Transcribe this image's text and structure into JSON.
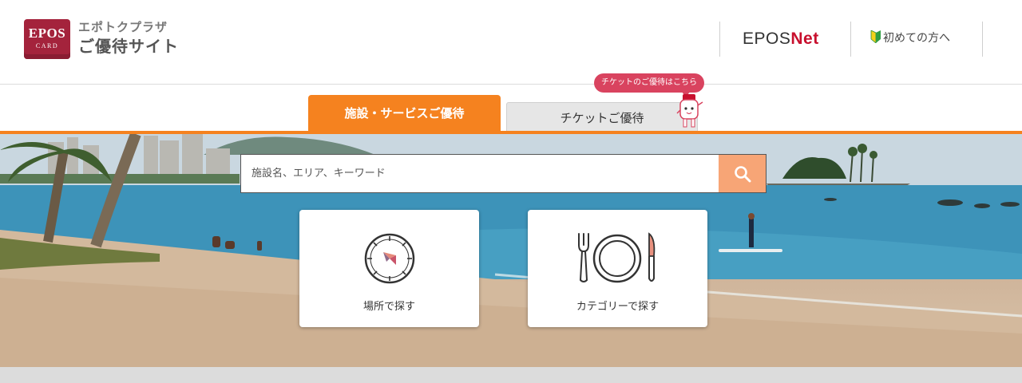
{
  "header": {
    "logo": {
      "line1": "EPOS",
      "line2": "CARD"
    },
    "site_kana": "エポトクプラザ",
    "site_title": "ご優待サイト",
    "eposnet": {
      "part1": "EPOS",
      "part2": "Net"
    },
    "first_time_link": "初めての方へ"
  },
  "tabs": {
    "active": "施設・サービスご優待",
    "inactive": "チケットご優待",
    "bubble": "チケットのご優待はこちら"
  },
  "search": {
    "placeholder": "施設名、エリア、キーワード",
    "value": "",
    "button_icon": "search-icon"
  },
  "cards": [
    {
      "label": "場所で探す",
      "icon": "compass-icon"
    },
    {
      "label": "カテゴリーで探す",
      "icon": "tableware-icon"
    }
  ],
  "colors": {
    "accent": "#f5821f",
    "search_button": "#f7a576",
    "brand_red": "#a4233c",
    "bubble": "#d9435f",
    "eposnet_red": "#c8102e"
  }
}
